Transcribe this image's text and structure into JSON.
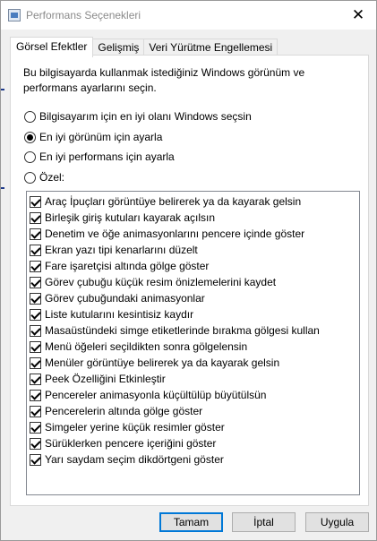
{
  "window": {
    "title": "Performans Seçenekleri",
    "close_glyph": "✕"
  },
  "tabs": [
    {
      "label": "Görsel Efektler",
      "active": true
    },
    {
      "label": "Gelişmiş",
      "active": false
    },
    {
      "label": "Veri Yürütme Engellemesi",
      "active": false
    }
  ],
  "description": "Bu bilgisayarda kullanmak istediğiniz Windows görünüm ve performans ayarlarını seçin.",
  "radios": [
    {
      "label": "Bilgisayarım için en iyi olanı Windows seçsin",
      "checked": false
    },
    {
      "label": "En iyi görünüm için ayarla",
      "checked": true
    },
    {
      "label": "En iyi performans için ayarla",
      "checked": false
    },
    {
      "label": "Özel:",
      "checked": false
    }
  ],
  "effects": [
    {
      "label": "Araç İpuçları görüntüye belirerek ya da kayarak gelsin",
      "checked": true
    },
    {
      "label": "Birleşik giriş kutuları kayarak açılsın",
      "checked": true
    },
    {
      "label": "Denetim ve öğe animasyonlarını pencere içinde göster",
      "checked": true
    },
    {
      "label": "Ekran yazı tipi kenarlarını düzelt",
      "checked": true
    },
    {
      "label": "Fare işaretçisi altında gölge göster",
      "checked": true
    },
    {
      "label": "Görev çubuğu küçük resim önizlemelerini kaydet",
      "checked": true
    },
    {
      "label": "Görev çubuğundaki animasyonlar",
      "checked": true
    },
    {
      "label": "Liste kutularını kesintisiz kaydır",
      "checked": true
    },
    {
      "label": "Masaüstündeki simge etiketlerinde bırakma gölgesi kullan",
      "checked": true
    },
    {
      "label": "Menü öğeleri seçildikten sonra gölgelensin",
      "checked": true
    },
    {
      "label": "Menüler görüntüye belirerek ya da kayarak gelsin",
      "checked": true
    },
    {
      "label": "Peek Özelliğini Etkinleştir",
      "checked": true
    },
    {
      "label": "Pencereler animasyonla küçültülüp büyütülsün",
      "checked": true
    },
    {
      "label": "Pencerelerin altında gölge göster",
      "checked": true
    },
    {
      "label": "Simgeler yerine küçük resimler göster",
      "checked": true
    },
    {
      "label": "Sürüklerken pencere içeriğini göster",
      "checked": true
    },
    {
      "label": "Yarı saydam seçim dikdörtgeni göster",
      "checked": true
    }
  ],
  "buttons": {
    "ok": "Tamam",
    "cancel": "İptal",
    "apply": "Uygula"
  },
  "colors": {
    "accent": "#0078d7",
    "title_text": "#8a8a8a"
  }
}
